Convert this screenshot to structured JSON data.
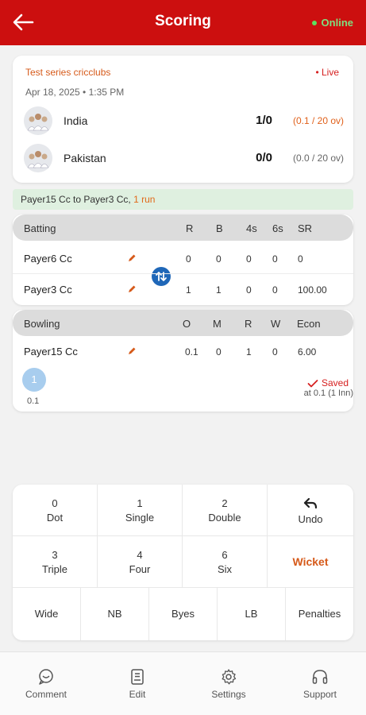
{
  "header": {
    "title": "Scoring",
    "status": "Online"
  },
  "match": {
    "series": "Test series cricclubs",
    "status": "• Live",
    "date": "Apr 18, 2025 • 1:35 PM",
    "teams": [
      {
        "name": "India",
        "score": "1/0",
        "overs": "(0.1 / 20 ov)",
        "overs_color": "#e0601a"
      },
      {
        "name": "Pakistan",
        "score": "0/0",
        "overs": "(0.0 / 20 ov)",
        "overs_color": "#666666"
      }
    ]
  },
  "commentary": {
    "text": "Payer15 Cc to  Payer3 Cc,",
    "runs": "1 run"
  },
  "batting": {
    "headers": [
      "Batting",
      "R",
      "B",
      "4s",
      "6s",
      "SR"
    ],
    "rows": [
      {
        "name": "Payer6 Cc",
        "r": "0",
        "b": "0",
        "fours": "0",
        "sixes": "0",
        "sr": "0"
      },
      {
        "name": "Payer3 Cc",
        "r": "1",
        "b": "1",
        "fours": "0",
        "sixes": "0",
        "sr": "100.00"
      }
    ]
  },
  "bowling": {
    "headers": [
      "Bowling",
      "O",
      "M",
      "R",
      "W",
      "Econ"
    ],
    "rows": [
      {
        "name": "Payer15 Cc",
        "o": "0.1",
        "m": "0",
        "r": "1",
        "w": "0",
        "econ": "6.00"
      }
    ]
  },
  "over_balls": [
    {
      "value": "1",
      "ball": "0.1"
    }
  ],
  "saved": {
    "label": "Saved",
    "sub": "at 0.1 (1 Inn)"
  },
  "keypad": {
    "row1": [
      {
        "num": "0",
        "label": "Dot"
      },
      {
        "num": "1",
        "label": "Single"
      },
      {
        "num": "2",
        "label": "Double"
      },
      {
        "num": "",
        "label": "Undo"
      }
    ],
    "row2": [
      {
        "num": "3",
        "label": "Triple"
      },
      {
        "num": "4",
        "label": "Four"
      },
      {
        "num": "6",
        "label": "Six"
      },
      {
        "num": "",
        "label": "Wicket"
      }
    ],
    "row3": [
      "Wide",
      "NB",
      "Byes",
      "LB",
      "Penalties"
    ]
  },
  "nav": [
    {
      "label": "Comment",
      "icon": "comment-icon"
    },
    {
      "label": "Edit",
      "icon": "edit-icon"
    },
    {
      "label": "Settings",
      "icon": "gear-icon"
    },
    {
      "label": "Support",
      "icon": "headset-icon"
    }
  ],
  "colors": {
    "brand": "#cc0f0f",
    "accent": "#d65a1a",
    "swap": "#1f67b8",
    "online": "#5ee05e"
  }
}
